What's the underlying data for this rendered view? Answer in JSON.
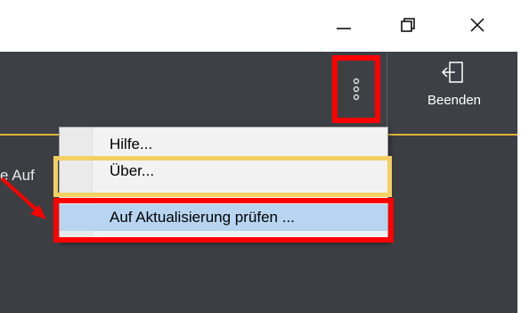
{
  "window": {
    "minimize_icon": "minimize-icon",
    "restore_icon": "restore-icon",
    "close_icon": "close-icon"
  },
  "toolbar": {
    "more_icon": "vertical-ellipsis-icon",
    "quit_icon": "exit-icon",
    "quit_label": "Beenden",
    "accent_color": "#e2b43a"
  },
  "content": {
    "partial_text": "e Auf"
  },
  "menu": {
    "items": [
      {
        "label": "Hilfe..."
      },
      {
        "label": "Über..."
      },
      {
        "label": "Auf Aktualisierung prüfen ..."
      }
    ],
    "selected_color": "#b7d5f0"
  },
  "annotations": {
    "highlight_red": "#ff0000",
    "highlight_yellow": "#f4cf62"
  }
}
